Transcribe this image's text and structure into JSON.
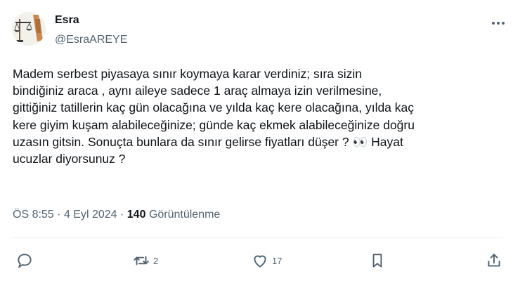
{
  "author": {
    "display_name": "Esra",
    "handle": "@EsraAREYE"
  },
  "tweet": {
    "text": "Madem serbest piyasaya sınır koymaya karar verdiniz; sıra sizin\nbindiğiniz araca , aynı aileye sadece 1 araç almaya izin verilmesine,\ngittiğiniz tatillerin kaç gün olacağına ve yılda kaç kere olacağına, yılda kaç\nkere giyim kuşam alabileceğinize; günde kaç ekmek alabileceğinize doğru\nuzasın gitsin. Sonuçta bunlara da sınır gelirse fiyatları düşer ? 👀 Hayat\nucuzlar diyorsunuz ?"
  },
  "meta": {
    "time": "ÖS 8:55",
    "separator": "·",
    "date": "4 Eyl 2024",
    "views_count": "140",
    "views_label": "Görüntülenme"
  },
  "actions": {
    "reply_count": "",
    "retweet_count": "2",
    "like_count": "17"
  },
  "icons": {
    "avatar": "scales-of-justice-avatar",
    "more": "more-options-icon",
    "reply": "reply-icon",
    "retweet": "retweet-icon",
    "like": "heart-icon",
    "bookmark": "bookmark-icon",
    "share": "share-icon"
  },
  "colors": {
    "text": "#0f1419",
    "secondary": "#536471",
    "divider": "#eff3f4"
  }
}
